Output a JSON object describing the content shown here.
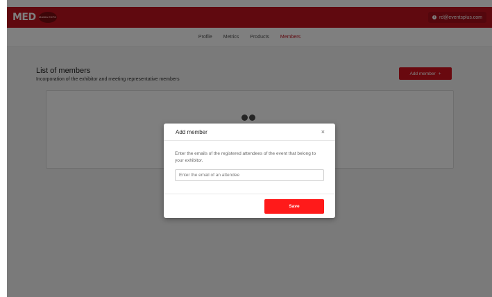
{
  "header": {
    "logo_text": "MED",
    "logo_badge": "MANIA EXPO",
    "user_email": "rd@eventsplus.com",
    "user_icon": "info-icon",
    "brand_color": "#c0121f"
  },
  "tabs": [
    {
      "label": "Profile",
      "active": false
    },
    {
      "label": "Metrics",
      "active": false
    },
    {
      "label": "Products",
      "active": false
    },
    {
      "label": "Members",
      "active": true
    }
  ],
  "members": {
    "title": "List of members",
    "subtitle": "Incorporation of the exhibitor and meeting representative members",
    "add_button_label": "Add member",
    "add_button_icon": "+"
  },
  "modal": {
    "title": "Add member",
    "close_icon": "×",
    "description": "Enter the emails of the registered attendees of the event that belong to your exhibitor.",
    "email_placeholder": "Enter the email of an attendee",
    "email_value": "",
    "save_label": "Save",
    "save_color": "#ff1a1a"
  }
}
